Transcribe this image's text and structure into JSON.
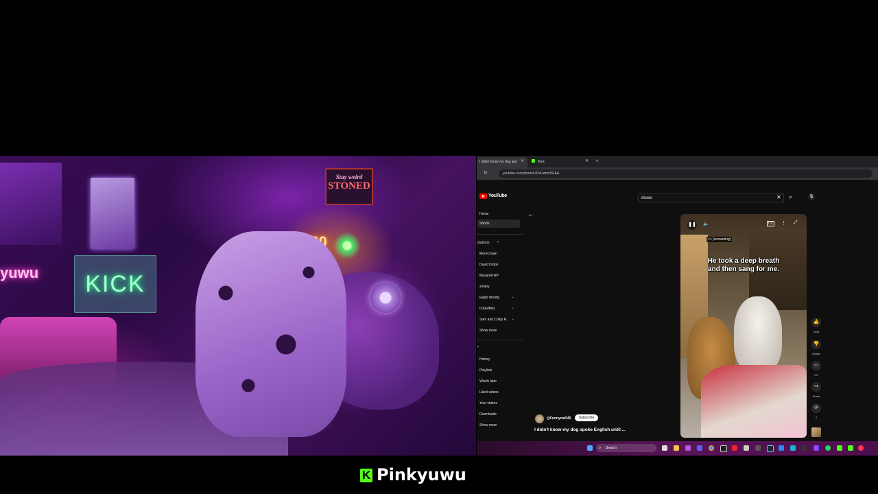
{
  "webcam": {
    "neon_sign_left": "Pinkyuwu",
    "neon_sign_left_visible": "yuwu",
    "kick_sign": "KICK",
    "poster_top": "Stay weird",
    "poster_stoned": "STONED",
    "neon_420": "420"
  },
  "browser": {
    "tabs": [
      {
        "label": "I didn't know my dog spo",
        "active": true
      },
      {
        "label": "Kick",
        "active": false
      }
    ],
    "url": "youtube.com/shorts/UDeUwmHGrEA"
  },
  "youtube": {
    "logo_text": "YouTube",
    "search_value": "druski",
    "sidebar": {
      "top": [
        "Home",
        "Shorts"
      ],
      "subscriptions_heading": "Subscriptions",
      "subscriptions_visible": "criptions",
      "channels": [
        "MoreCrown",
        "David Drops",
        "Maxamill RP",
        "zimery",
        "Elijah Wordly",
        "ICkEdMeL",
        "Sam and Colby R...",
        "Show more"
      ],
      "you": [
        "History",
        "Playlists",
        "Watch later",
        "Liked videos",
        "Your videos",
        "Downloads",
        "Show more"
      ]
    },
    "short": {
      "overlay_tag": ">> [screaming]",
      "caption_line1": "He took a deep breath",
      "caption_line2": "and then sang for me.",
      "channel": "@Funnycat545",
      "subscribe_label": "Subscribe",
      "title": "I didn't know my dog spoke English until ..."
    },
    "actions": {
      "like_count": "163K",
      "dislike_label": "Dislike",
      "comments_count": "727",
      "share_label": "Share",
      "remix_count": "2"
    }
  },
  "taskbar": {
    "search_label": "Search"
  },
  "streamer": {
    "name": "Pinkyuwu",
    "logo_letter": "K"
  },
  "colors": {
    "kick_green": "#53fc18",
    "youtube_red": "#ff0000"
  }
}
